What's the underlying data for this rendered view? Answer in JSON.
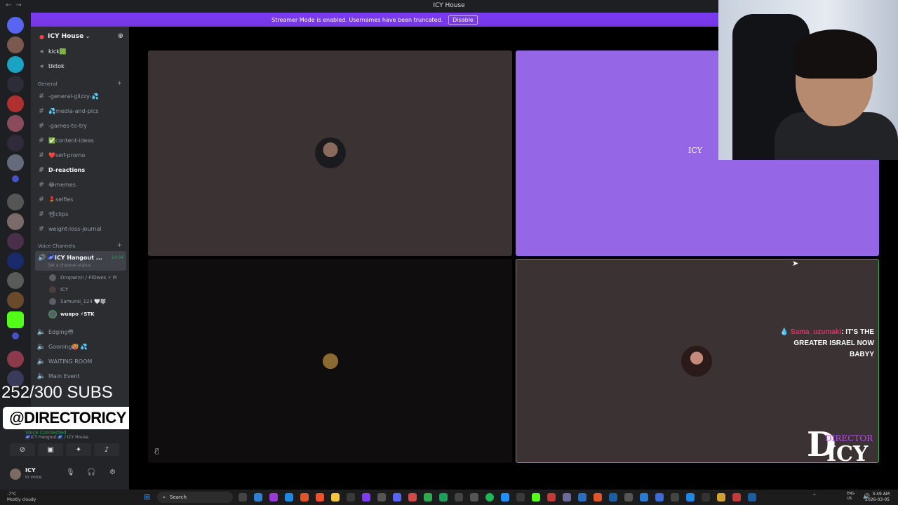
{
  "window": {
    "title": "ICY House"
  },
  "banner": {
    "text": "Streamer Mode is enabled. Usernames have been truncated.",
    "button": "Disable"
  },
  "server": {
    "name": "ICY House"
  },
  "channels_top": [
    {
      "label": "kick🟩",
      "type": "announce"
    },
    {
      "label": "tiktok",
      "type": "announce"
    }
  ],
  "category_general": {
    "label": "General"
  },
  "text_channels": [
    {
      "label": "-general-glizzy-💦",
      "emoji": "👥"
    },
    {
      "label": "💦media-and-pics",
      "emoji": ""
    },
    {
      "label": "-games-to-try",
      "emoji": "🐅"
    },
    {
      "label": "✅content-ideas",
      "emoji": ""
    },
    {
      "label": "❤️self-promo",
      "emoji": ""
    },
    {
      "label": "D-reactions",
      "emoji": ""
    },
    {
      "label": "😂memes",
      "emoji": ""
    },
    {
      "label": "💄selfies",
      "emoji": ""
    },
    {
      "label": "📽clips",
      "emoji": ""
    },
    {
      "label": "weight-loss-journal",
      "emoji": ""
    }
  ],
  "category_voice": {
    "label": "Voice Channels"
  },
  "active_voice": {
    "name": "🌌ICY Hangout ...",
    "status": "Set a channel status",
    "timer": "14:04"
  },
  "voice_members": [
    {
      "name": "Dropwinn / FlOwes ⚡ Pi"
    },
    {
      "name": "ICY"
    },
    {
      "name": "Samurai_124 🤍🐺"
    },
    {
      "name": "wuapo ⚡STK"
    }
  ],
  "voice_channels": [
    {
      "label": "Edging😳"
    },
    {
      "label": "Gooning🥵 💦"
    },
    {
      "label": "WAITING ROOM"
    },
    {
      "label": "Main Event"
    }
  ],
  "overlay": {
    "subs": "252/300 SUBS",
    "handle": "@DIRECTORICY"
  },
  "voice_panel": {
    "status": "Voice Connected",
    "location": "🌌ICY Hangout 🌌 / ICY House"
  },
  "user_panel": {
    "name": "ICY",
    "status": "In voice"
  },
  "chat": {
    "user": "Sama_uzumaki",
    "message": ": IT'S THE GREATER ISRAEL NOW BABYY"
  },
  "logo": {
    "top": "DIRECTOR",
    "bottom": "ICY"
  },
  "tile_label": {
    "text": "ICY"
  },
  "taskbar": {
    "weather_temp": "-7°C",
    "weather_desc": "Mostly cloudy",
    "search": "Search",
    "lang1": "ENG",
    "lang2": "US",
    "time": "3:49 AM",
    "date": "2026-03-05"
  },
  "colors": {
    "banner": "#7437e6",
    "speaking": "#3ba55c",
    "tile_purple": "#9567e6"
  }
}
